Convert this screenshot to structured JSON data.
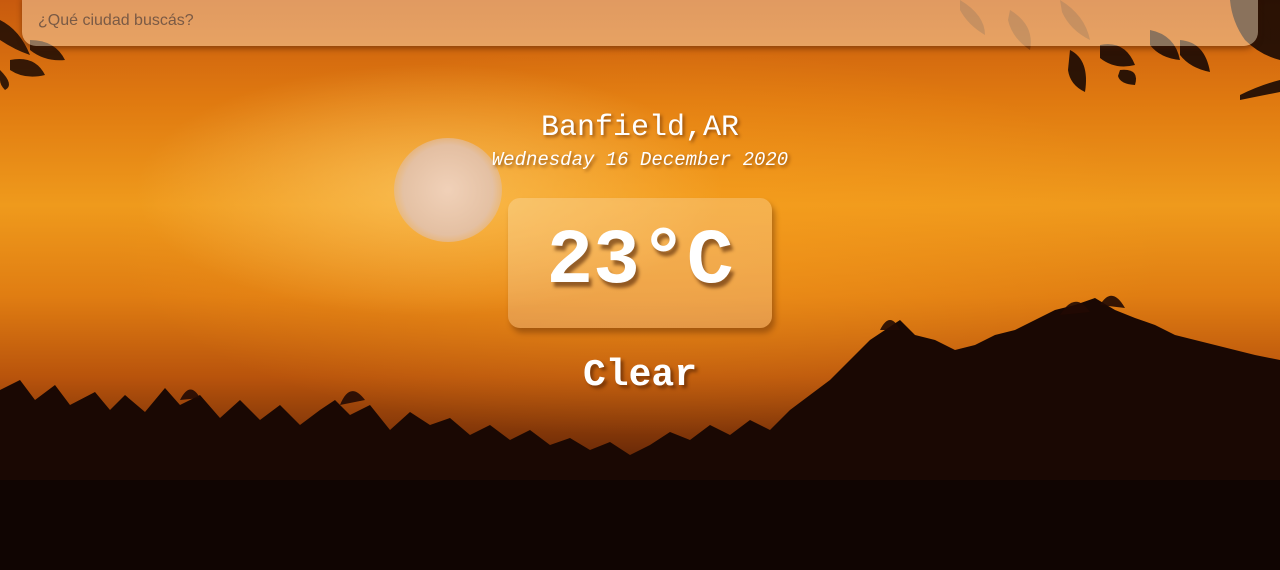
{
  "search": {
    "placeholder": "¿Qué ciudad buscás?"
  },
  "location": {
    "city_country": "Banfield,AR",
    "date": "Wednesday 16 December 2020"
  },
  "weather": {
    "temperature": "23°C",
    "condition": "Clear"
  },
  "colors": {
    "sky_top": "#c85a0e",
    "sky_glow": "#ef9a1c",
    "ground": "#0c0502",
    "text": "#ffffff"
  },
  "icons": {
    "sun": "sun-icon"
  }
}
